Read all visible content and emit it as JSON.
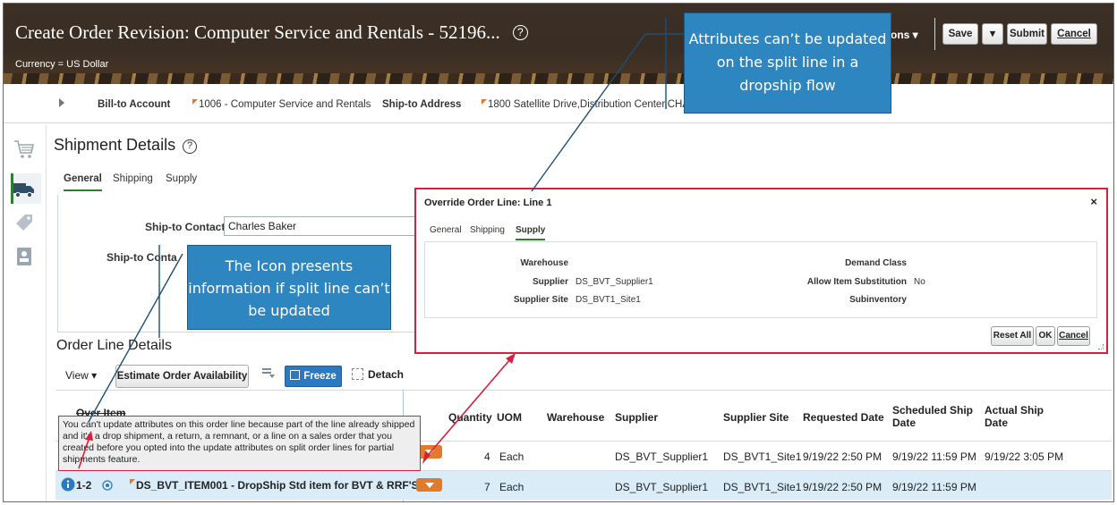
{
  "header": {
    "title": "Create Order Revision: Computer Service and Rentals - 52196...",
    "help_glyph": "?",
    "currency": "Currency = US Dollar",
    "actions_label": "ons ▾",
    "buttons": {
      "save": "Save",
      "save_menu": "▾",
      "submit": "Submit",
      "cancel": "Cancel"
    }
  },
  "infobar": {
    "bill_to_label": "Bill-to Account",
    "bill_to_value": "1006 - Computer Service and Rentals",
    "ship_to_label": "Ship-to Address",
    "ship_to_value": "1800 Satellite Drive,Distribution Center,CHAT"
  },
  "rail_icons": [
    "cart-icon",
    "truck-icon",
    "tag-icon",
    "contact-card-icon"
  ],
  "shipment": {
    "title": "Shipment Details",
    "tabs": [
      "General",
      "Shipping",
      "Supply"
    ],
    "ship_to_contact_label": "Ship-to Contact",
    "ship_to_contact_value": "Charles Baker",
    "ship_to_contact2_label": "Ship-to Conta"
  },
  "callouts": {
    "top": "Attributes can’t be updated on the split line in a dropship flow",
    "middle": "The Icon presents information if split line can’t be updated"
  },
  "dialog": {
    "title": "Override Order Line: Line 1",
    "close": "×",
    "tabs": [
      "General",
      "Shipping",
      "Supply"
    ],
    "fields": {
      "warehouse_label": "Warehouse",
      "supplier_label": "Supplier",
      "supplier_value": "DS_BVT_Supplier1",
      "supplier_site_label": "Supplier Site",
      "supplier_site_value": "DS_BVT1_Site1",
      "demand_class_label": "Demand Class",
      "allow_sub_label": "Allow Item Substitution",
      "allow_sub_value": "No",
      "subinventory_label": "Subinventory"
    },
    "buttons": {
      "reset_all": "Reset All",
      "ok": "OK",
      "cancel": "Cancel"
    }
  },
  "order_lines": {
    "title": "Order Line Details",
    "view_label": "View ▾",
    "estimate_button": "Estimate Order Availability",
    "freeze_button": "Freeze",
    "detach_button": "Detach",
    "columns": {
      "item": "Over Item",
      "quantity": "Quantity",
      "uom": "UOM",
      "warehouse": "Warehouse",
      "supplier": "Supplier",
      "supplier_site": "Supplier Site",
      "requested_date": "Requested Date",
      "scheduled_ship_date_1": "Scheduled Ship",
      "scheduled_ship_date_2": "Date",
      "actual_ship_date_1": "Actual Ship",
      "actual_ship_date_2": "Date"
    },
    "rows": [
      {
        "quantity": "4",
        "uom": "Each",
        "supplier": "DS_BVT_Supplier1",
        "supplier_site": "DS_BVT1_Site1",
        "requested_date": "9/19/22 2:50 PM",
        "scheduled_ship_date": "9/19/22 11:59 PM",
        "actual_ship_date": "9/19/22 3:05 PM"
      },
      {
        "line": "1-2",
        "item": "DS_BVT_ITEM001 - DropShip Std item for BVT & RRF'S",
        "quantity": "7",
        "uom": "Each",
        "supplier": "DS_BVT_Supplier1",
        "supplier_site": "DS_BVT1_Site1",
        "requested_date": "9/19/22 2:50 PM",
        "scheduled_ship_date": "9/19/22 11:59 PM",
        "actual_ship_date": ""
      }
    ],
    "tooltip": "You can't update attributes on this order line because part of the line already shipped and it's a drop shipment, a return, a remnant, or a line on a sales order that you created before you opted into the update attributes on split order lines for partial shipments feature."
  },
  "colors": {
    "accent_blue": "#2e86c1",
    "highlight_red": "#d4213d",
    "orange": "#e07a2d",
    "selected_row": "#d9ecf8"
  }
}
